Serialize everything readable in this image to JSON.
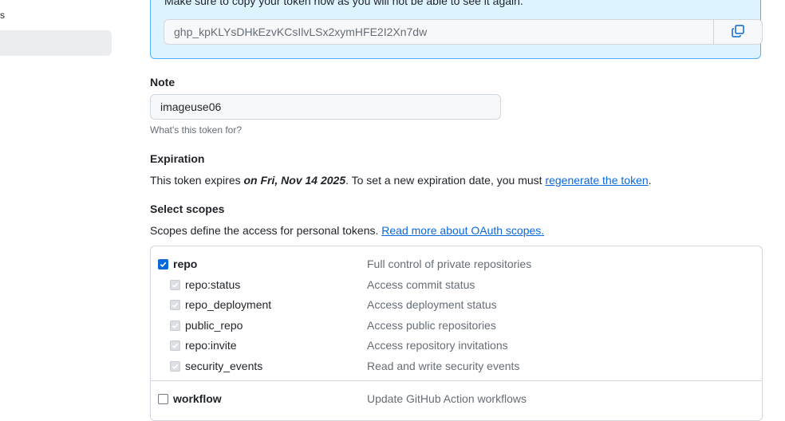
{
  "sidebar": {
    "fragment": "s"
  },
  "flash": {
    "message": "Make sure to copy your token now as you will not be able to see it again.",
    "token_value": "ghp_kpKLYsDHkEzvKCsIlvLSx2xymHFE2I2Xn7dw",
    "copy_icon": "copy-icon"
  },
  "note": {
    "label": "Note",
    "value": "imageuse06",
    "hint": "What's this token for?"
  },
  "expiration": {
    "label": "Expiration",
    "text_before": "This token expires ",
    "date": "on Fri, Nov 14 2025",
    "text_after": ". To set a new expiration date, you must ",
    "link": "regenerate the token",
    "text_end": "."
  },
  "scopes": {
    "label": "Select scopes",
    "text": "Scopes define the access for personal tokens. ",
    "link": "Read more about OAuth scopes.",
    "items": [
      {
        "name": "repo",
        "desc": "Full control of private repositories",
        "state": "checked",
        "level": 0
      },
      {
        "name": "repo:status",
        "desc": "Access commit status",
        "state": "disabled",
        "level": 1
      },
      {
        "name": "repo_deployment",
        "desc": "Access deployment status",
        "state": "disabled",
        "level": 1
      },
      {
        "name": "public_repo",
        "desc": "Access public repositories",
        "state": "disabled",
        "level": 1
      },
      {
        "name": "repo:invite",
        "desc": "Access repository invitations",
        "state": "disabled",
        "level": 1
      },
      {
        "name": "security_events",
        "desc": "Read and write security events",
        "state": "disabled",
        "level": 1
      },
      {
        "name": "workflow",
        "desc": "Update GitHub Action workflows",
        "state": "unchecked",
        "level": 0
      }
    ]
  },
  "colors": {
    "accent": "#0969da",
    "flash_bg": "#ddf4ff",
    "flash_border": "#54aeff"
  }
}
